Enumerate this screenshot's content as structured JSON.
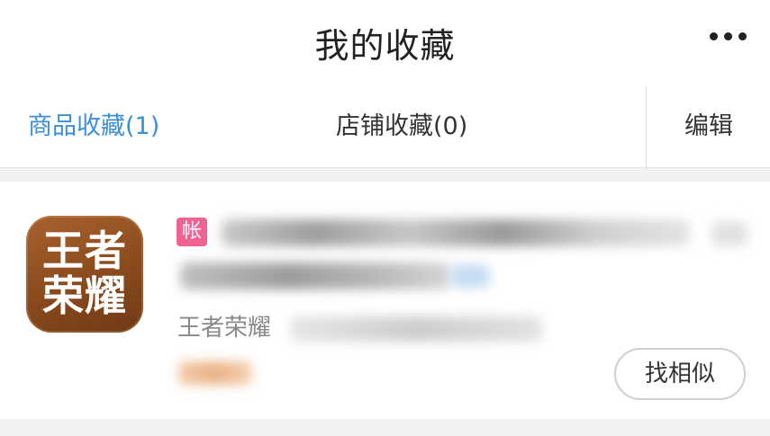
{
  "header": {
    "title": "我的收藏",
    "more_icon": "more-dots-icon"
  },
  "tabs": [
    {
      "label": "商品收藏(1)",
      "active": true
    },
    {
      "label": "店铺收藏(0)",
      "active": false
    }
  ],
  "edit_label": "编辑",
  "accent_color": "#3a8fd8",
  "item": {
    "logo_text": "王者荣耀",
    "tag": "帐",
    "tag_color": "#f06292",
    "game_name": "王者荣耀",
    "similar_button": "找相似"
  }
}
